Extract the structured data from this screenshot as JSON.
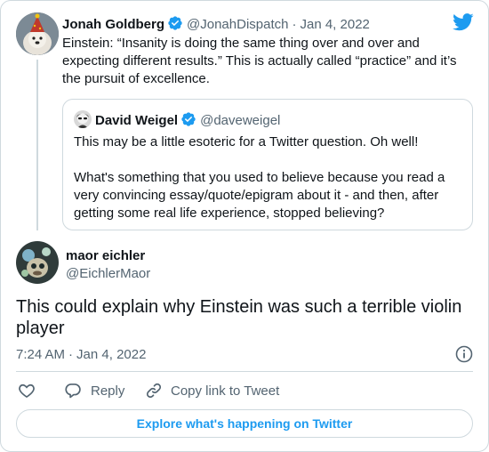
{
  "main_tweet": {
    "author_name": "Jonah Goldberg",
    "handle": "@JonahDispatch",
    "separator": "·",
    "date": "Jan 4, 2022",
    "text": "Einstein: “Insanity is doing the same thing over and over and expecting different results.” This is actually called “practice” and it’s the pursuit of excellence."
  },
  "quoted_tweet": {
    "author_name": "David Weigel",
    "handle": "@daveweigel",
    "paragraph_1": "This may be a little esoteric for a Twitter question. Oh well!",
    "paragraph_2": "What's something that you used to believe because you read a very convincing essay/quote/epigram about it - and then, after getting some real life experience, stopped believing?"
  },
  "reply_tweet": {
    "author_name": "maor eichler",
    "handle": "@EichlerMaor",
    "text": "This could explain why Einstein was such a terrible violin player",
    "time": "7:24 AM",
    "separator": "·",
    "date": "Jan 4, 2022"
  },
  "actions": {
    "like_icon": "heart-icon",
    "reply_label": "Reply",
    "copy_link_label": "Copy link to Tweet"
  },
  "explore_label": "Explore what's happening on Twitter",
  "colors": {
    "twitter_blue": "#1d9bf0",
    "text_primary": "#0f1419",
    "text_secondary": "#536471",
    "border": "#cfd9de"
  }
}
